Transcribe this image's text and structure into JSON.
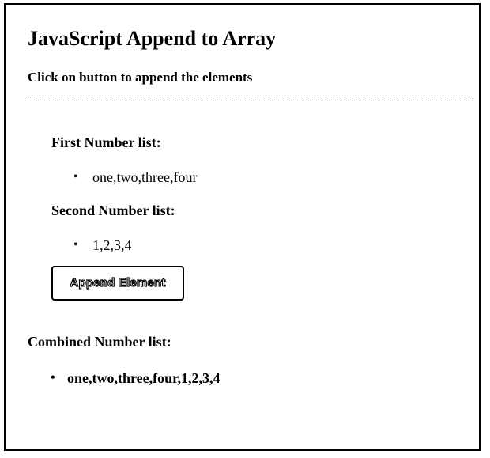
{
  "page": {
    "title": "JavaScript Append to Array",
    "instruction": "Click on button to append the elements"
  },
  "first_list": {
    "label": "First Number list:",
    "items": [
      "one,two,three,four"
    ]
  },
  "second_list": {
    "label": "Second Number list:",
    "items": [
      "1,2,3,4"
    ]
  },
  "append_button": {
    "label": "Append Element"
  },
  "combined_list": {
    "label": "Combined Number list:",
    "items": [
      "one,two,three,four,1,2,3,4"
    ]
  },
  "icons": {
    "bullet": "bullet-icon"
  },
  "colors": {
    "border": "#000000",
    "background": "#ffffff",
    "text": "#000000"
  }
}
